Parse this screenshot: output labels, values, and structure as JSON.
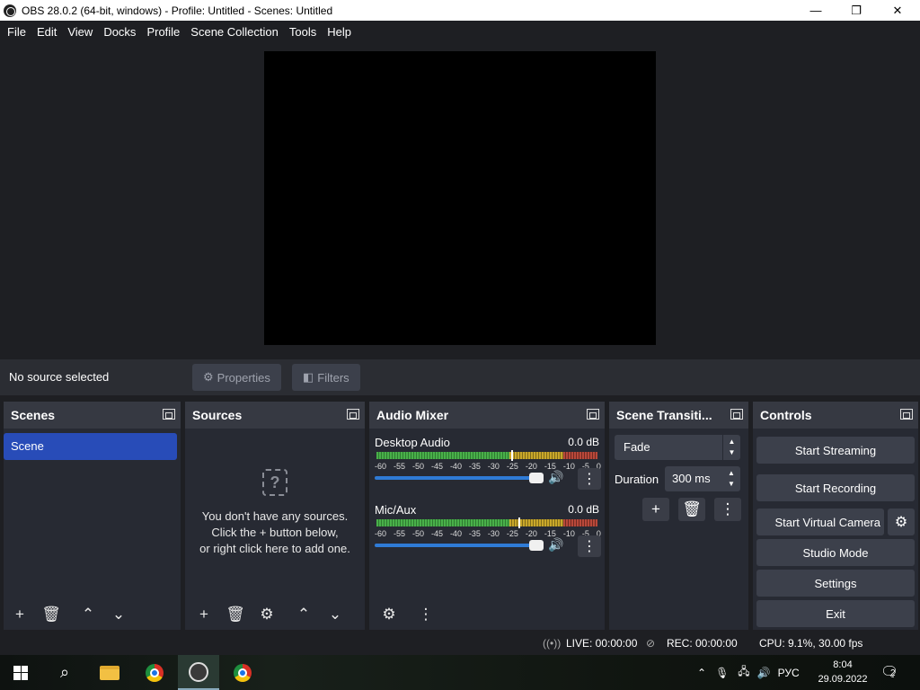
{
  "window": {
    "title": "OBS 28.0.2 (64-bit, windows) - Profile: Untitled - Scenes: Untitled",
    "minimize": "—",
    "maximize": "❐",
    "close": "✕"
  },
  "menu": [
    "File",
    "Edit",
    "View",
    "Docks",
    "Profile",
    "Scene Collection",
    "Tools",
    "Help"
  ],
  "context": {
    "no_source": "No source selected",
    "properties": "Properties",
    "filters": "Filters"
  },
  "scenes": {
    "title": "Scenes",
    "items": [
      "Scene"
    ]
  },
  "sources": {
    "title": "Sources",
    "empty_line1": "You don't have any sources.",
    "empty_line2": "Click the + button below,",
    "empty_line3": "or right click here to add one."
  },
  "mixer": {
    "title": "Audio Mixer",
    "scale": [
      "-60",
      "-55",
      "-50",
      "-45",
      "-40",
      "-35",
      "-30",
      "-25",
      "-20",
      "-15",
      "-10",
      "-5",
      "0"
    ],
    "channels": [
      {
        "name": "Desktop Audio",
        "db": "0.0 dB",
        "volume": 1.0
      },
      {
        "name": "Mic/Aux",
        "db": "0.0 dB",
        "volume": 1.0
      }
    ]
  },
  "transitions": {
    "title": "Scene Transiti...",
    "selected": "Fade",
    "duration_label": "Duration",
    "duration_value": "300 ms"
  },
  "controls": {
    "title": "Controls",
    "start_streaming": "Start Streaming",
    "start_recording": "Start Recording",
    "start_virtual_camera": "Start Virtual Camera",
    "studio_mode": "Studio Mode",
    "settings": "Settings",
    "exit": "Exit"
  },
  "status": {
    "live": "LIVE: 00:00:00",
    "rec": "REC: 00:00:00",
    "cpu": "CPU: 9.1%, 30.00 fps"
  },
  "taskbar": {
    "lang": "РУС",
    "time": "8:04",
    "date": "29.09.2022",
    "notifications": "2"
  }
}
